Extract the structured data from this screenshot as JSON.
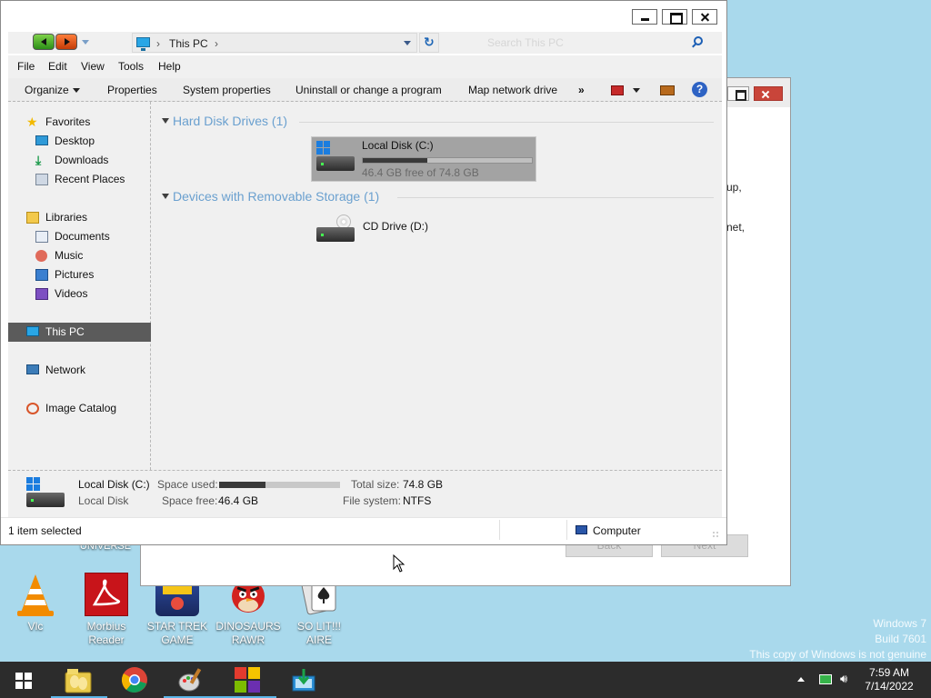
{
  "desktop": {
    "icons": [
      {
        "label": "Vlc"
      },
      {
        "label": "Morbius Reader"
      },
      {
        "label": "STAR TREK GAME"
      },
      {
        "label": "DINOSAURS RAWR"
      },
      {
        "label": "SO LIT!!! AIRE"
      }
    ],
    "partial_label": "UNIVERSE",
    "watermark": {
      "line1": "Windows 7",
      "line2": "Build 7601",
      "line3": "This copy of Windows is not genuine"
    }
  },
  "background_window": {
    "text_fragments": [
      "up,",
      "net,"
    ],
    "back_label": "Back",
    "next_label": "Next"
  },
  "explorer": {
    "address": {
      "crumb": "This PC",
      "separator": "›"
    },
    "search_placeholder": "Search This PC",
    "menu": [
      "File",
      "Edit",
      "View",
      "Tools",
      "Help"
    ],
    "commands": {
      "organize": "Organize",
      "properties": "Properties",
      "system_properties": "System properties",
      "uninstall": "Uninstall or change a program",
      "map_drive": "Map network drive",
      "more": "»"
    },
    "nav": {
      "favorites": "Favorites",
      "desktop": "Desktop",
      "downloads": "Downloads",
      "recent_places": "Recent Places",
      "libraries": "Libraries",
      "documents": "Documents",
      "music": "Music",
      "pictures": "Pictures",
      "videos": "Videos",
      "this_pc": "This PC",
      "network": "Network",
      "image_catalog": "Image Catalog"
    },
    "groups": {
      "hard_disks": "Hard Disk Drives (1)",
      "removable": "Devices with Removable Storage (1)"
    },
    "drives": {
      "c": {
        "name": "Local Disk (C:)",
        "free_text": "46.4 GB free of 74.8 GB",
        "used_fraction": 0.38
      },
      "d": {
        "name": "CD Drive (D:)"
      }
    },
    "details": {
      "name": "Local Disk (C:)",
      "type": "Local Disk",
      "space_used_label": "Space used:",
      "space_free_label": "Space free:",
      "space_free_value": "46.4 GB",
      "total_size_label": "Total size:",
      "total_size_value": "74.8 GB",
      "file_system_label": "File system:",
      "file_system_value": "NTFS",
      "used_fraction": 0.38
    },
    "status": {
      "selected": "1 item selected",
      "location": "Computer"
    }
  },
  "taskbar": {
    "time": "7:59 AM",
    "date": "7/14/2022"
  }
}
